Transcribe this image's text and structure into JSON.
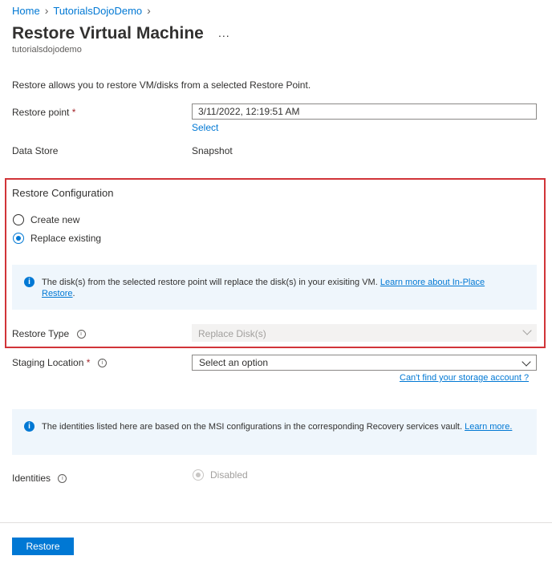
{
  "breadcrumb": {
    "home": "Home",
    "item": "TutorialsDojoDemo"
  },
  "header": {
    "title": "Restore Virtual Machine",
    "more": "...",
    "subtitle": "tutorialsdojodemo"
  },
  "description": "Restore allows you to restore VM/disks from a selected Restore Point.",
  "restore_point": {
    "label": "Restore point",
    "required": "*",
    "value": "3/11/2022, 12:19:51 AM",
    "select_link": "Select"
  },
  "data_store": {
    "label": "Data Store",
    "value": "Snapshot"
  },
  "restore_config": {
    "title": "Restore Configuration",
    "options": [
      "Create new",
      "Replace existing"
    ],
    "selected": "Replace existing",
    "info_text": "The disk(s) from the selected restore point will replace the disk(s) in your exisiting VM.",
    "info_link": "Learn more about In-Place Restore",
    "restore_type_label": "Restore Type",
    "restore_type_value": "Replace Disk(s)"
  },
  "staging": {
    "label": "Staging Location",
    "required": "*",
    "value": "Select an option",
    "storage_link": "Can't find your storage account ?"
  },
  "identities_info": {
    "text": "The identities listed here are based on the MSI configurations in the corresponding Recovery services vault.",
    "link": "Learn more."
  },
  "identities": {
    "label": "Identities",
    "value": "Disabled"
  },
  "footer": {
    "restore_button": "Restore"
  },
  "colors": {
    "accent": "#0078d4",
    "highlight_border": "#d13438",
    "info_bg": "#eff6fc"
  }
}
